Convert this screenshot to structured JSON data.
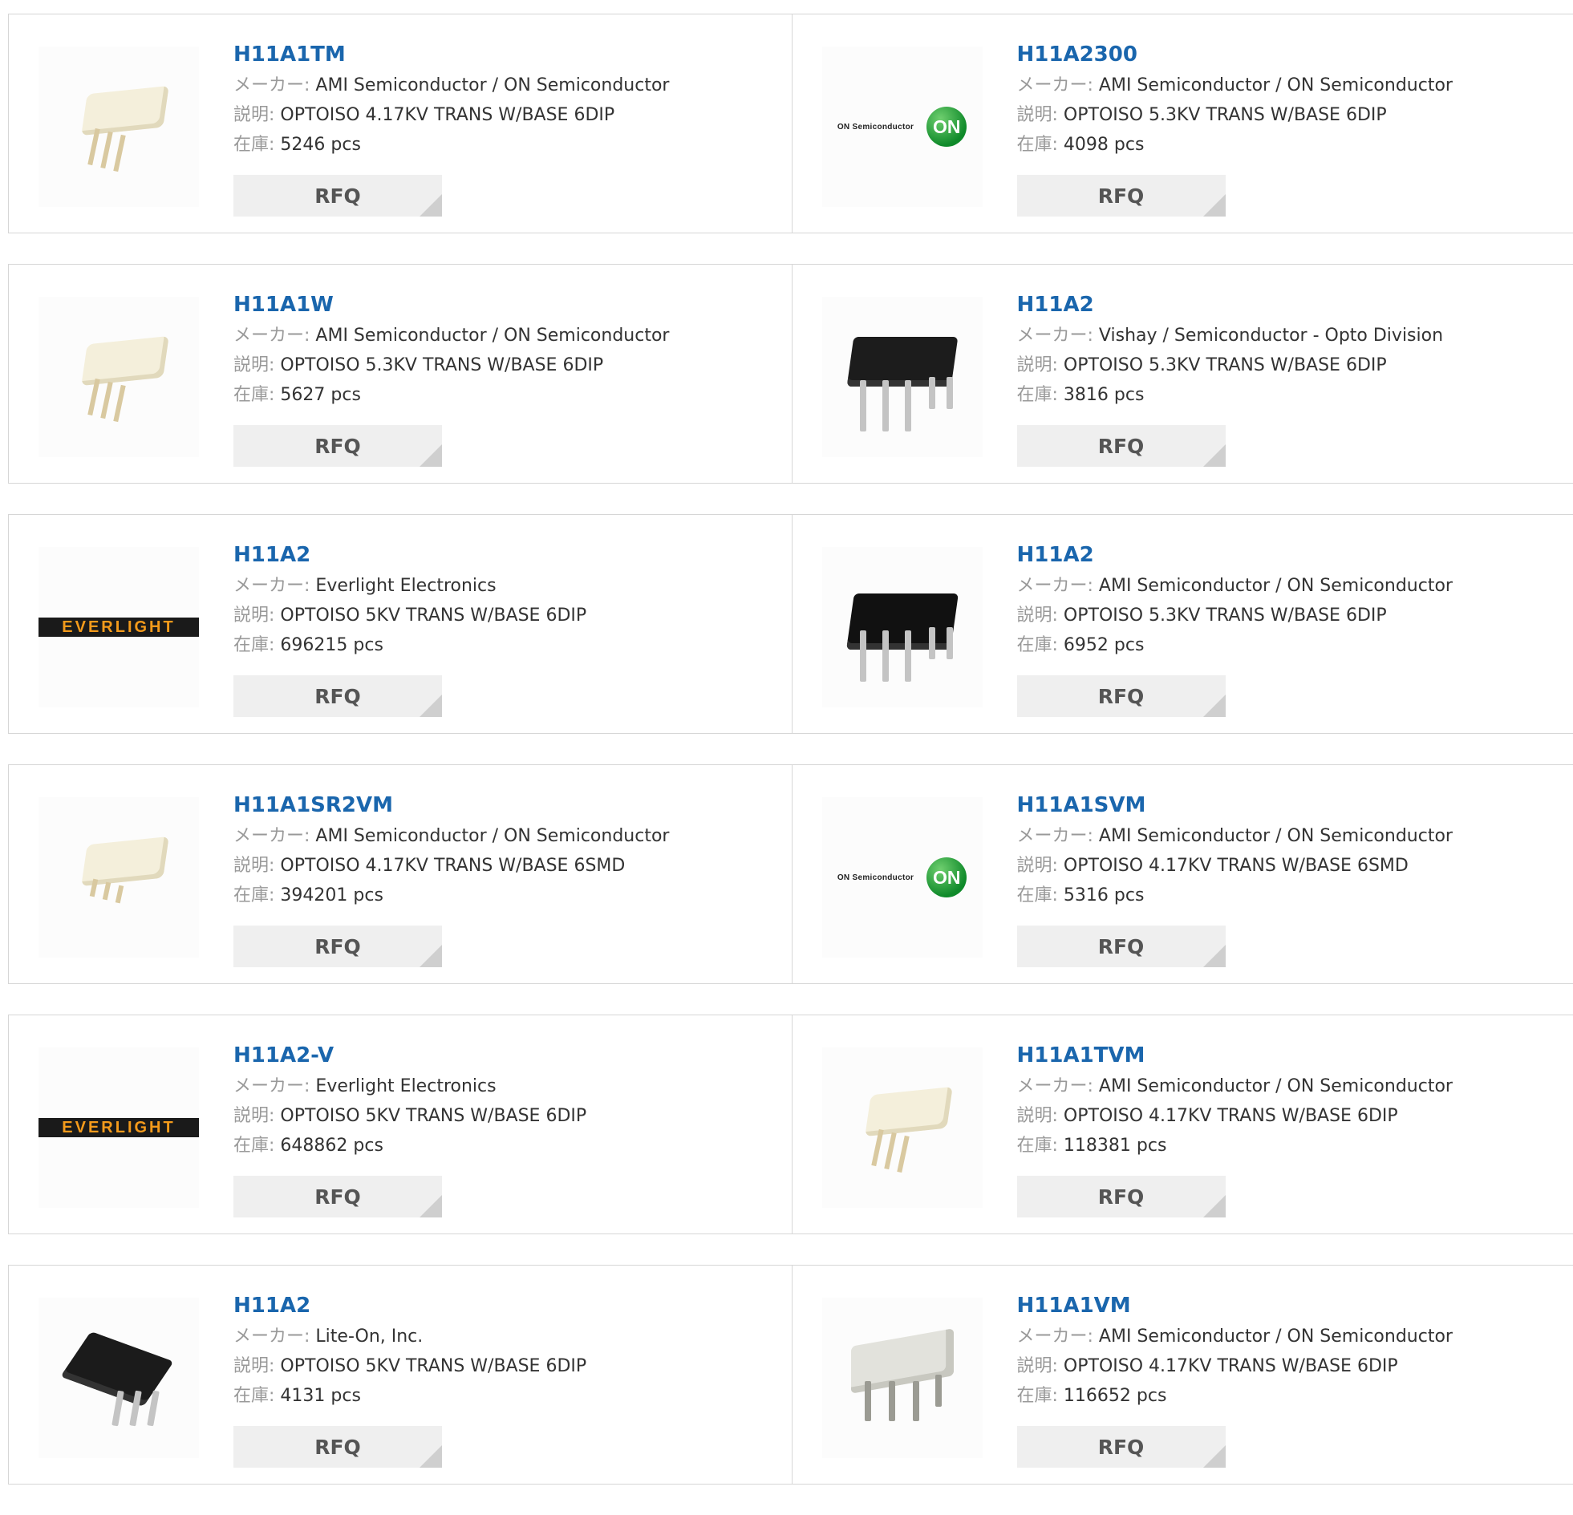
{
  "labels": {
    "maker": "メーカー:",
    "desc": "説明:",
    "stock": "在庫:",
    "rfq": "RFQ"
  },
  "colors": {
    "link": "#1a66ad",
    "rfq_bg": "#efefef",
    "border": "#d6d6d6",
    "on_green": "#0f8a2a",
    "everlight_orange": "#f39a1b"
  },
  "products": [
    {
      "name": "H11A1TM",
      "maker": "AMI Semiconductor / ON Semiconductor",
      "desc": "OPTOISO 4.17KV TRANS W/BASE 6DIP",
      "stock": "5246 pcs",
      "image": "white-dip-chip"
    },
    {
      "name": "H11A2300",
      "maker": "AMI Semiconductor / ON Semiconductor",
      "desc": "OPTOISO 5.3KV TRANS W/BASE 6DIP",
      "stock": "4098 pcs",
      "image": "on-semiconductor-logo",
      "logo_text": "ON Semiconductor",
      "logo_badge": "ON"
    },
    {
      "name": "H11A1W",
      "maker": "AMI Semiconductor / ON Semiconductor",
      "desc": "OPTOISO 5.3KV TRANS W/BASE 6DIP",
      "stock": "5627 pcs",
      "image": "white-dip-chip"
    },
    {
      "name": "H11A2",
      "maker": "Vishay / Semiconductor - Opto Division",
      "desc": "OPTOISO 5.3KV TRANS W/BASE 6DIP",
      "stock": "3816 pcs",
      "image": "black-dip-chip"
    },
    {
      "name": "H11A2",
      "maker": "Everlight Electronics",
      "desc": "OPTOISO 5KV TRANS W/BASE 6DIP",
      "stock": "696215 pcs",
      "image": "everlight-logo",
      "logo_text": "EVERLIGHT"
    },
    {
      "name": "H11A2",
      "maker": "AMI Semiconductor / ON Semiconductor",
      "desc": "OPTOISO 5.3KV TRANS W/BASE 6DIP",
      "stock": "6952 pcs",
      "image": "black-dip-chip"
    },
    {
      "name": "H11A1SR2VM",
      "maker": "AMI Semiconductor / ON Semiconductor",
      "desc": "OPTOISO 4.17KV TRANS W/BASE 6SMD",
      "stock": "394201 pcs",
      "image": "white-smd-chip"
    },
    {
      "name": "H11A1SVM",
      "maker": "AMI Semiconductor / ON Semiconductor",
      "desc": "OPTOISO 4.17KV TRANS W/BASE 6SMD",
      "stock": "5316 pcs",
      "image": "on-semiconductor-logo",
      "logo_text": "ON Semiconductor",
      "logo_badge": "ON"
    },
    {
      "name": "H11A2-V",
      "maker": "Everlight Electronics",
      "desc": "OPTOISO 5KV TRANS W/BASE 6DIP",
      "stock": "648862 pcs",
      "image": "everlight-logo",
      "logo_text": "EVERLIGHT"
    },
    {
      "name": "H11A1TVM",
      "maker": "AMI Semiconductor / ON Semiconductor",
      "desc": "OPTOISO 4.17KV TRANS W/BASE 6DIP",
      "stock": "118381 pcs",
      "image": "white-dip-chip"
    },
    {
      "name": "H11A2",
      "maker": "Lite-On, Inc.",
      "desc": "OPTOISO 5KV TRANS W/BASE 6DIP",
      "stock": "4131 pcs",
      "image": "black-lite-on-chip"
    },
    {
      "name": "H11A1VM",
      "maker": "AMI Semiconductor / ON Semiconductor",
      "desc": "OPTOISO 4.17KV TRANS W/BASE 6DIP",
      "stock": "116652 pcs",
      "image": "grey-dip-chip"
    }
  ]
}
